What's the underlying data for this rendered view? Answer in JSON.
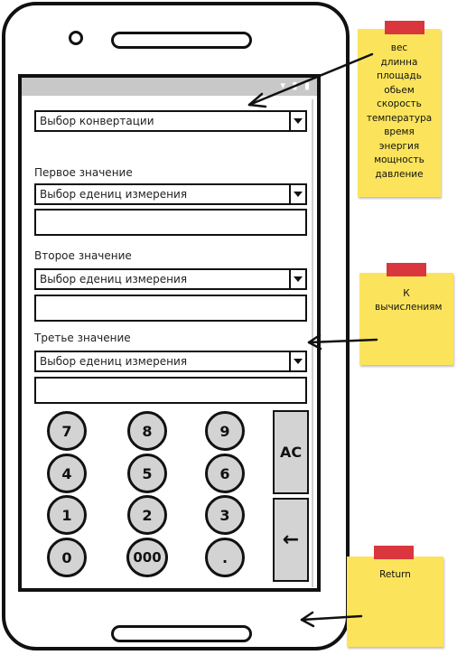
{
  "screen": {
    "conversion_select": "Выбор конвертации",
    "first_label": "Первое значение",
    "first_unit_select": "Выбор едениц измерения",
    "first_value": "",
    "second_label": "Второе значение",
    "second_unit_select": "Выбор едениц измерения",
    "second_value": "",
    "third_label": "Третье значение",
    "third_unit_select": "Выбор едениц измерения",
    "third_value": ""
  },
  "keypad": {
    "k7": "7",
    "k8": "8",
    "k9": "9",
    "k4": "4",
    "k5": "5",
    "k6": "6",
    "k1": "1",
    "k2": "2",
    "k3": "3",
    "k0": "0",
    "k000": "000",
    "kdot": ".",
    "clear": "AC",
    "backspace": "←"
  },
  "notes": {
    "units_list": [
      "вес",
      "длинна",
      "площадь",
      "обьем",
      "скорость",
      "температура",
      "время",
      "энергия",
      "мощность",
      "давление"
    ],
    "calc_note": "К вычислениям",
    "return_note": "Return"
  },
  "colors": {
    "note_yellow": "#fbe45b",
    "tape_red": "#d9363e",
    "key_gray": "#d3d3d3",
    "status_gray": "#c8c8c8"
  }
}
